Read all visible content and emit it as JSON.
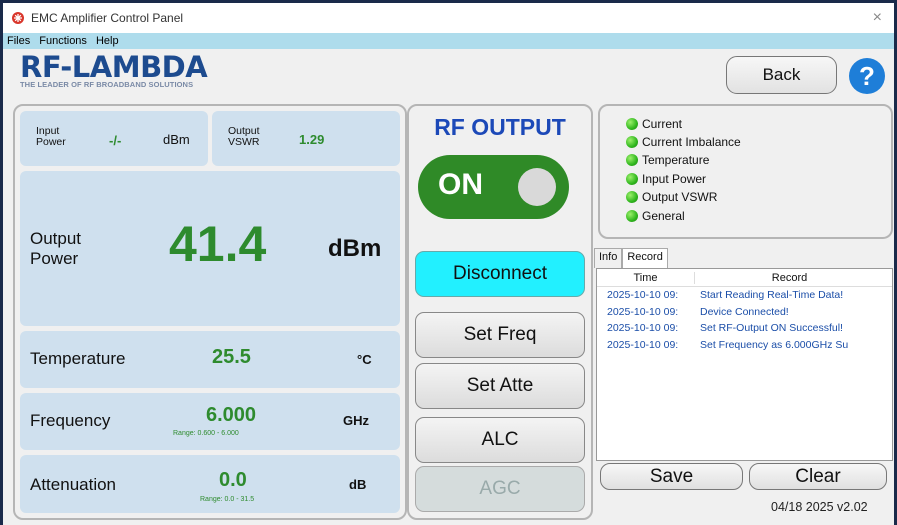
{
  "window": {
    "title": "EMC Amplifier Control Panel",
    "close": "×"
  },
  "menu": [
    "Files",
    "Functions",
    "Help"
  ],
  "brand": {
    "logo": "RF-LAMBDA",
    "tagline": "THE LEADER OF RF BROADBAND SOLUTIONS"
  },
  "header": {
    "back_label": "Back",
    "help_label": "?"
  },
  "readouts": {
    "input_power": {
      "label_line1": "Input",
      "label_line2": "Power",
      "value": "-/-",
      "unit": "dBm"
    },
    "output_vswr": {
      "label_line1": "Output",
      "label_line2": "VSWR",
      "value": "1.29"
    },
    "output_power": {
      "label_line1": "Output",
      "label_line2": "Power",
      "value": "41.4",
      "unit": "dBm"
    },
    "temperature": {
      "label": "Temperature",
      "value": "25.5",
      "unit": "°C"
    },
    "frequency": {
      "label": "Frequency",
      "value": "6.000",
      "unit": "GHz",
      "range": "Range: 0.600 - 6.000"
    },
    "attenuation": {
      "label": "Attenuation",
      "value": "0.0",
      "unit": "dB",
      "range": "Range: 0.0 - 31.5"
    }
  },
  "rf_output": {
    "title": "RF OUTPUT",
    "state": "ON"
  },
  "controls": {
    "disconnect": "Disconnect",
    "set_freq": "Set Freq",
    "set_atte": "Set Atte",
    "alc": "ALC",
    "agc": "AGC"
  },
  "status": [
    "Current",
    "Current Imbalance",
    "Temperature",
    "Input Power",
    "Output VSWR",
    "General"
  ],
  "tabs": {
    "info": "Info",
    "record": "Record"
  },
  "record_table": {
    "headers": [
      "Time",
      "Record"
    ],
    "rows": [
      [
        "2025-10-10 09:",
        "Start Reading Real-Time Data!"
      ],
      [
        "2025-10-10 09:",
        "Device Connected!"
      ],
      [
        "2025-10-10 09:",
        "Set RF-Output ON Successful!"
      ],
      [
        "2025-10-10 09:",
        "Set Frequency as 6.000GHz Su"
      ]
    ]
  },
  "record_actions": {
    "save": "Save",
    "clear": "Clear"
  },
  "footer": {
    "version": "04/18 2025 v2.02"
  },
  "colors": {
    "accent_green": "#2e8b2e",
    "toggle_green": "#2f8a27",
    "disconnect_cyan": "#22f0ff",
    "card_blue": "#cfe0ee",
    "menu_blue": "#aedcec"
  }
}
